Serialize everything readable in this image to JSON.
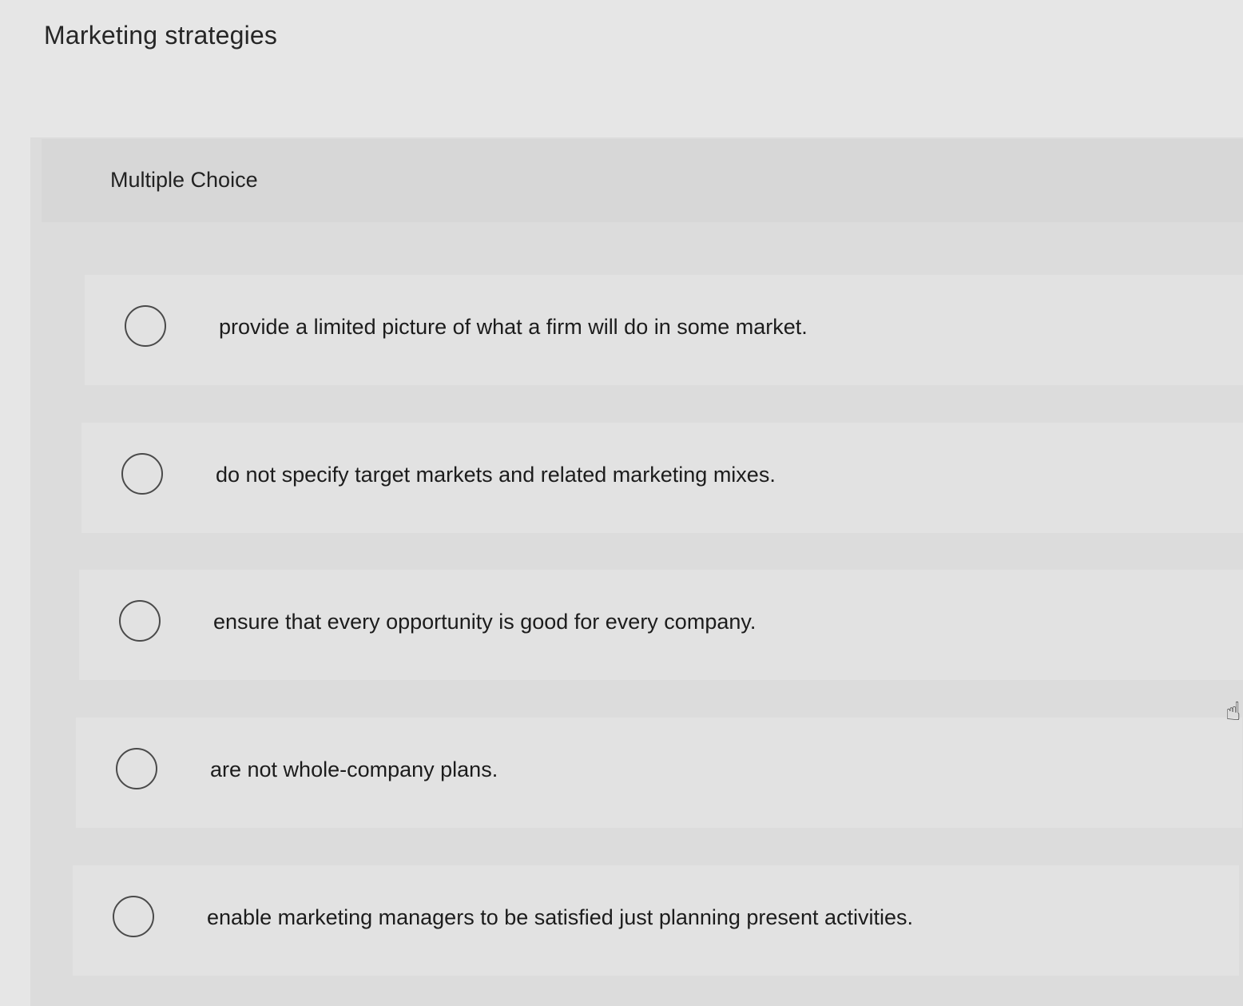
{
  "question": {
    "title": "Marketing strategies",
    "type_label": "Multiple Choice"
  },
  "options": [
    {
      "text": "provide a limited picture of what a firm will do in some market."
    },
    {
      "text": "do not specify target markets and related marketing mixes."
    },
    {
      "text": "ensure that every opportunity is good for every company."
    },
    {
      "text": "are not whole-company plans."
    },
    {
      "text": "enable marketing managers to be satisfied just planning present activities."
    }
  ],
  "cursor": {
    "icon": "hand-pointer-icon",
    "glyph": "☝"
  }
}
